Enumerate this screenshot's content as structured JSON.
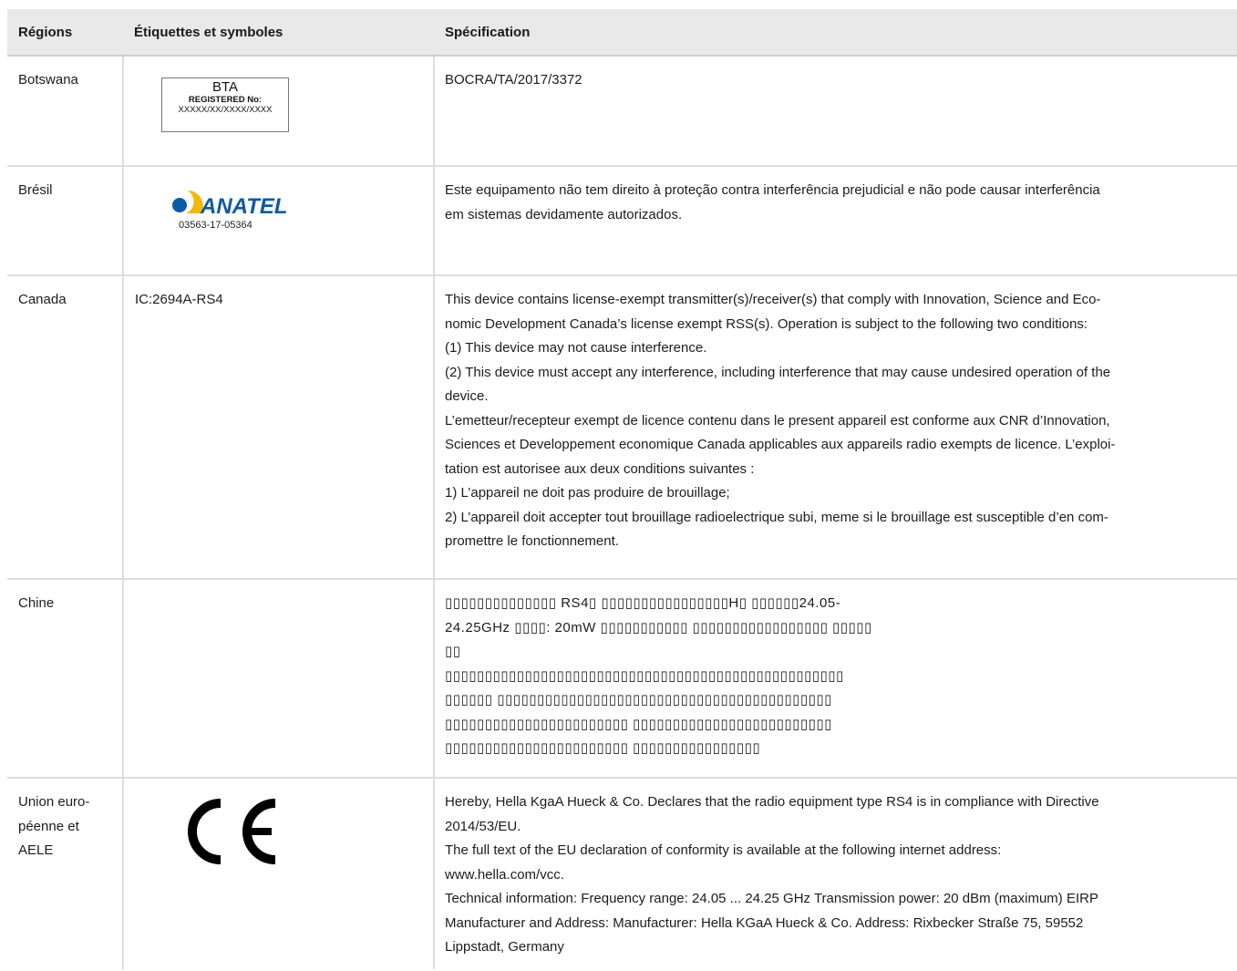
{
  "table": {
    "headers": [
      "Régions",
      "Étiquettes et symboles",
      "Spécification"
    ],
    "rows": [
      {
        "region_lines": [
          "Botswana"
        ],
        "label": {
          "type": "bta-label",
          "line1": "BTA",
          "line2": "REGISTERED No:",
          "line3": "XXXXX/XX/XXXX/XXXX"
        },
        "spec_lines": [
          "BOCRA/TA/2017/3372"
        ]
      },
      {
        "region_lines": [
          "Brésil"
        ],
        "label": {
          "type": "anatel-logo",
          "logo_text": "ANATEL",
          "number": "03563-17-05364",
          "colors": {
            "yellow": "#f5b800",
            "blue": "#0d5aa7"
          }
        },
        "spec_lines": [
          "Este equipamento não tem direito à proteção contra interferência prejudicial e não pode causar interferência",
          "em sistemas devidamente autorizados."
        ]
      },
      {
        "region_lines": [
          "Canada"
        ],
        "label_text": "IC:2694A-RS4",
        "spec_lines": [
          "This device contains license-exempt transmitter(s)/receiver(s) that comply with Innovation, Science and Eco-",
          "nomic Development Canada’s license exempt RSS(s). Operation is subject to the following two conditions:",
          "(1) This device may not cause interference.",
          "(2) This device must accept any interference, including interference that may cause undesired operation of the",
          "device.",
          "L’emetteur/recepteur exempt de licence contenu dans le present appareil est conforme aux CNR d’Innovation,",
          "Sciences et Developpement economique Canada applicables aux appareils radio exempts de licence. L’exploi-",
          "tation est autorisee aux deux conditions suivantes :",
          "1) L’appareil ne doit pas produire de brouillage;",
          "2) L’appareil doit accepter tout brouillage radioelectrique subi, meme si le brouillage est susceptible d’en com-",
          "promettre le fonctionnement."
        ]
      },
      {
        "region_lines": [
          "Chine"
        ],
        "spec_lines": [
          "▯▯▯▯▯▯▯▯▯▯▯▯▯▯ RS4▯ ▯▯▯▯▯▯▯▯▯▯▯▯▯▯▯▯H▯ ▯▯▯▯▯▯24.05-",
          "24.25GHz ▯▯▯▯: 20mW ▯▯▯▯▯▯▯▯▯▯▯ ▯▯▯▯▯▯▯▯▯▯▯▯▯▯▯▯▯ ▯▯▯▯▯",
          "▯▯",
          "▯▯▯▯▯▯▯▯▯▯▯▯▯▯▯▯▯▯▯▯▯▯▯▯▯▯▯▯▯▯▯▯▯▯▯▯▯▯▯▯▯▯▯▯▯▯▯▯▯▯",
          "▯▯▯▯▯▯ ▯▯▯▯▯▯▯▯▯▯▯▯▯▯▯▯▯▯▯▯▯▯▯▯▯▯▯▯▯▯▯▯▯▯▯▯▯▯▯▯▯▯",
          "▯▯▯▯▯▯▯▯▯▯▯▯▯▯▯▯▯▯▯▯▯▯▯ ▯▯▯▯▯▯▯▯▯▯▯▯▯▯▯▯▯▯▯▯▯▯▯▯▯",
          "▯▯▯▯▯▯▯▯▯▯▯▯▯▯▯▯▯▯▯▯▯▯▯ ▯▯▯▯▯▯▯▯▯▯▯▯▯▯▯▯"
        ]
      },
      {
        "region_lines": [
          "Union euro-",
          "péenne et",
          "AELE"
        ],
        "label": {
          "type": "ce-mark",
          "text": "CE"
        },
        "spec_lines": [
          "Hereby, Hella KgaA Hueck & Co. Declares that the radio equipment type RS4 is in compliance with Directive",
          "2014/53/EU.",
          "The full text of the EU declaration of conformity is available at the following internet address:",
          "www.hella.com/vcc.",
          "Technical information: Frequency range: 24.05 ... 24.25 GHz Transmission power: 20 dBm (maximum) EIRP",
          "Manufacturer and Address: Manufacturer: Hella KGaA Hueck & Co. Address: Rixbecker Straße 75, 59552",
          "Lippstadt, Germany"
        ]
      }
    ]
  }
}
